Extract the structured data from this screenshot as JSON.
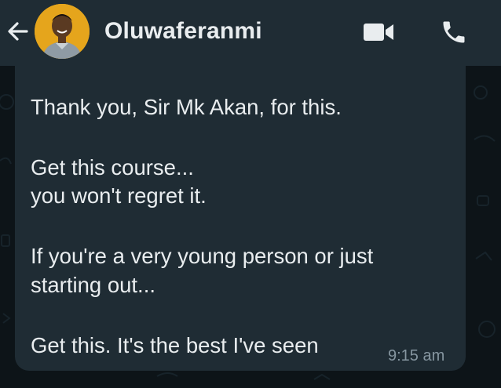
{
  "header": {
    "back_icon": "arrow-left-icon",
    "avatar_icon": "contact-avatar",
    "contact_name": "Oluwaferanmi",
    "video_icon": "video-call-icon",
    "call_icon": "phone-call-icon"
  },
  "message": {
    "lines": [
      "Thank you, Sir Mk Akan, for this.",
      "Get this course...",
      "you won't regret it.",
      "If you're a very young person or just",
      "starting out...",
      "Get this. It's the best I've seen"
    ],
    "time": "9:15 am"
  },
  "colors": {
    "header_bg": "#1f2c34",
    "bubble_bg": "#1f2c34",
    "chat_bg": "#0d1418",
    "text": "#e9edef",
    "meta_text": "#8696a0",
    "avatar_bg": "#e5a51c"
  }
}
